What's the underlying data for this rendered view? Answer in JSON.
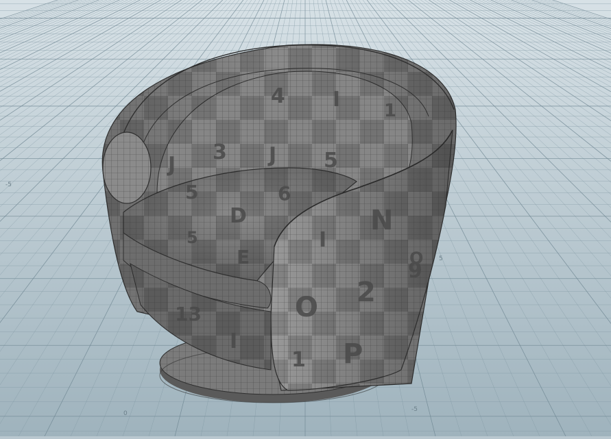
{
  "scene": {
    "background_top": "#d7e1e6",
    "background_bottom": "#9fb3bd",
    "grid_color": "#7f96a2",
    "grid_major_color": "#6c8490",
    "mesh_base": "#7a7a7a",
    "mesh_dark": "#5c5c5c",
    "mesh_light": "#9a9a9a",
    "wire_color": "#2f2f2f",
    "object": "swivel-barrel-chair"
  },
  "grid_labels": [
    "-5",
    "5",
    "0",
    "-5"
  ],
  "uv_glyphs": {
    "back": [
      "4",
      "I",
      "J",
      "3",
      "J",
      "5",
      "1"
    ],
    "seat": [
      "5",
      "6",
      "D",
      "E",
      "5"
    ],
    "arm": [
      "N",
      "I",
      "O",
      "2",
      "9",
      "O",
      "P",
      "1"
    ],
    "front": [
      "13",
      "I"
    ]
  }
}
